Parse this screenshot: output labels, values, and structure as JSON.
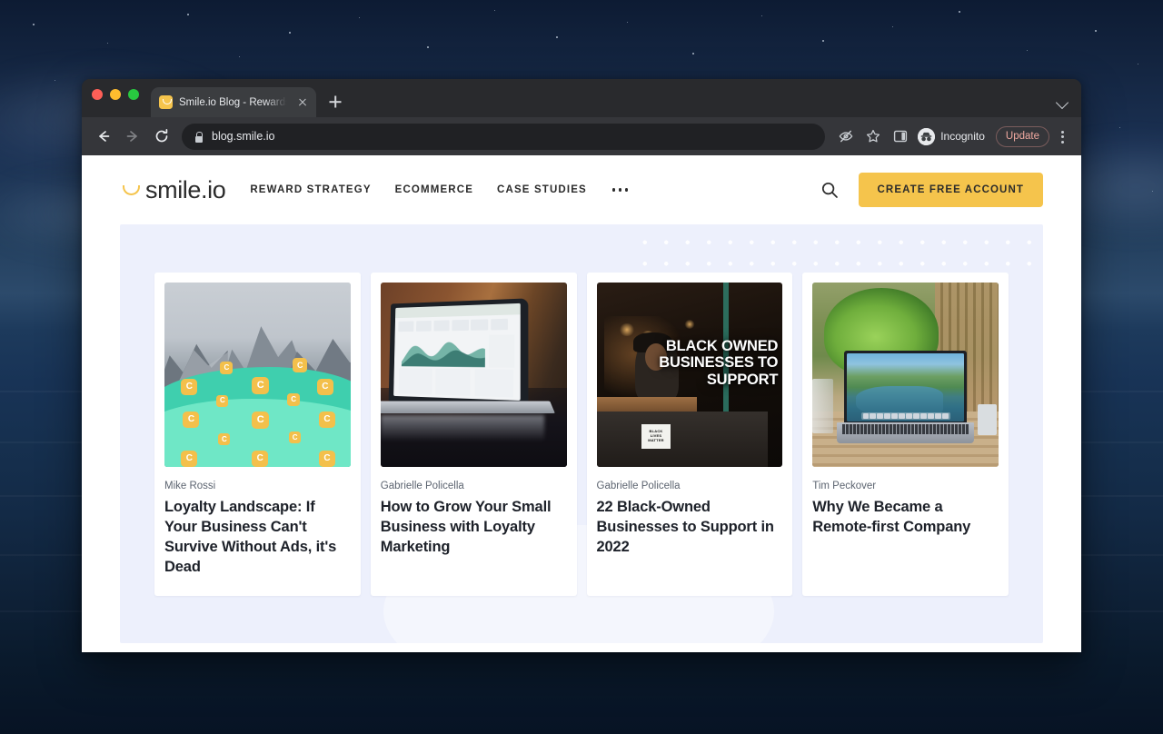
{
  "browser": {
    "tab": {
      "title": "Smile.io Blog - Rewards, Loyal",
      "favicon_icon": "smile-favicon",
      "close_icon": "close-icon"
    },
    "new_tab_icon": "plus-icon",
    "window_chevron_icon": "chevron-down-icon",
    "back_icon": "back-arrow-icon",
    "forward_icon": "forward-arrow-icon",
    "reload_icon": "reload-icon",
    "lock_icon": "lock-icon",
    "url": "blog.smile.io",
    "tracking_icon": "eye-slash-icon",
    "bookmark_icon": "star-icon",
    "sidepanel_icon": "side-panel-icon",
    "profile_icon": "incognito-icon",
    "profile_label": "Incognito",
    "update_label": "Update",
    "menu_icon": "kebab-menu-icon"
  },
  "site": {
    "logo": {
      "mark_icon": "smile-arc-icon",
      "text": "smile.io"
    },
    "nav": [
      {
        "label": "REWARD STRATEGY"
      },
      {
        "label": "ECOMMERCE"
      },
      {
        "label": "CASE STUDIES"
      }
    ],
    "nav_more_icon": "ellipsis-icon",
    "search_icon": "search-icon",
    "cta_label": "CREATE FREE ACCOUNT",
    "colors": {
      "brand_yellow": "#f5c44c",
      "panel_lavender": "#edf0fc",
      "text_dark": "#1d2129",
      "mint": "#3fcfae"
    }
  },
  "featured": {
    "cards": [
      {
        "author": "Mike Rossi",
        "title": "Loyalty Landscape: If Your Business Can't Survive Without Ads, it's Dead",
        "image_name": "mountain-lake-coins-illustration",
        "coin_letter": "C"
      },
      {
        "author": "Gabrielle Policella",
        "title": "How to Grow Your Small Business with Loyalty Marketing",
        "image_name": "laptop-analytics-dashboard-photo"
      },
      {
        "author": "Gabrielle Policella",
        "title": "22 Black-Owned Businesses to Support in 2022",
        "image_name": "black-owned-business-storefront-photo",
        "overlay_text": "BLACK OWNED BUSINESSES TO SUPPORT",
        "sign_lines": [
          "BLACK",
          "LIVES",
          "MATTER"
        ]
      },
      {
        "author": "Tim Peckover",
        "title": "Why We Became a Remote-first Company",
        "image_name": "macbook-outdoor-garden-photo"
      }
    ]
  }
}
